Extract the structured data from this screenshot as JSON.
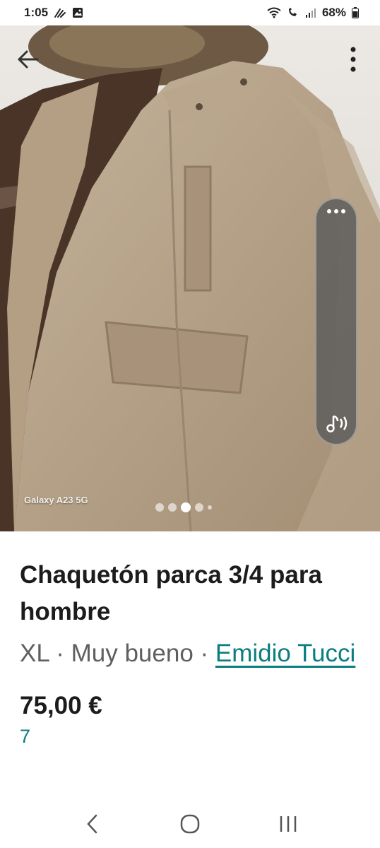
{
  "status": {
    "time": "1:05",
    "battery": "68%",
    "icons_left": [
      "gesture-icon",
      "image-icon"
    ],
    "icons_right": [
      "wifi-icon",
      "call-icon",
      "signal-icon",
      "battery-icon"
    ]
  },
  "photo": {
    "watermark": "Galaxy A23 5G",
    "page_count": 5,
    "active_page": 3
  },
  "product": {
    "title": "Chaquetón parca 3/4 para hombre",
    "size": "XL",
    "separator": " · ",
    "condition": "Muy bueno",
    "brand": "Emidio Tucci",
    "price": "75,00 €",
    "likes": "7"
  },
  "colors": {
    "accent": "#0a7d7f",
    "text": "#1c1c1c",
    "muted": "#5f5f5f"
  }
}
